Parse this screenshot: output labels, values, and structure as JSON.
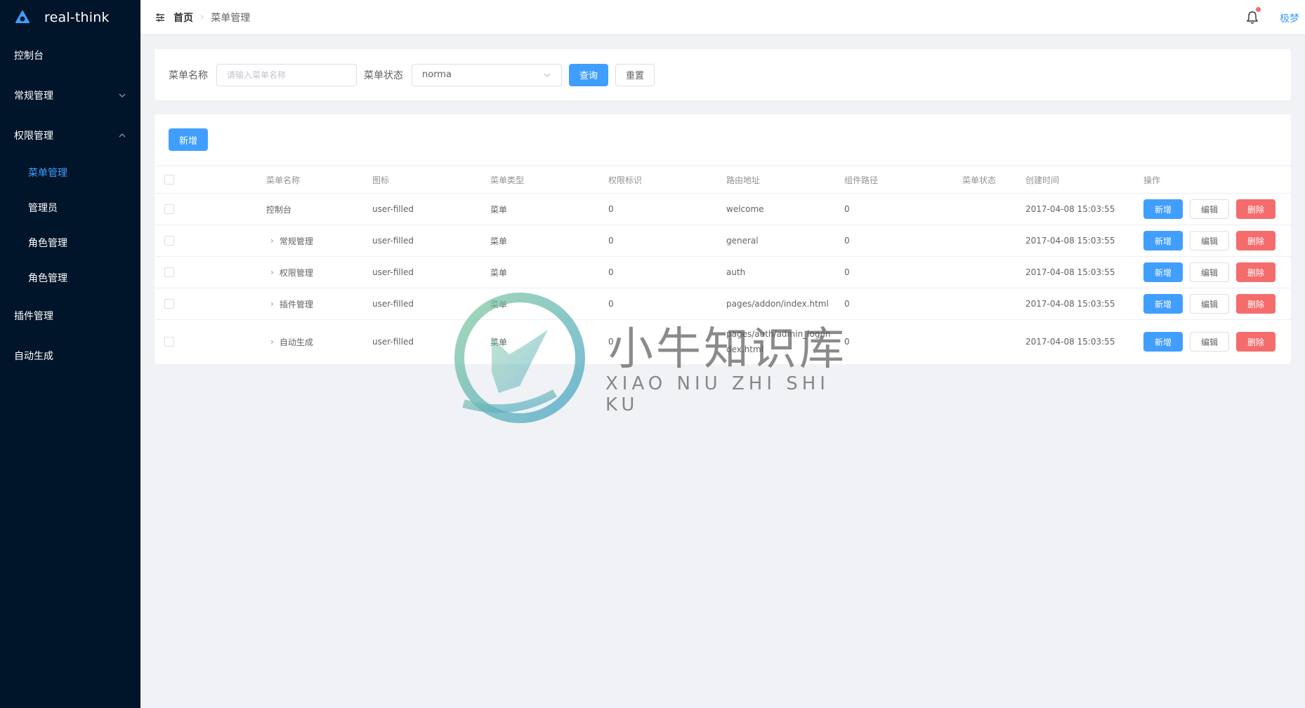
{
  "app": {
    "name": "real-think"
  },
  "sidebar": {
    "items": [
      {
        "label": "控制台"
      },
      {
        "label": "常规管理"
      },
      {
        "label": "权限管理"
      },
      {
        "label": "插件管理"
      },
      {
        "label": "自动生成"
      }
    ],
    "subitems": [
      {
        "label": "菜单管理",
        "active": true
      },
      {
        "label": "管理员"
      },
      {
        "label": "角色管理"
      },
      {
        "label": "角色管理"
      }
    ]
  },
  "header": {
    "breadcrumb_home": "首页",
    "breadcrumb_current": "菜单管理",
    "user": "极梦"
  },
  "search": {
    "name_label": "菜单名称",
    "name_placeholder": "请输入菜单名称",
    "status_label": "菜单状态",
    "status_value": "norma",
    "query_button": "查询",
    "reset_button": "重置"
  },
  "toolbar": {
    "add_label": "新增"
  },
  "table": {
    "columns": [
      "菜单名称",
      "图标",
      "菜单类型",
      "权限标识",
      "路由地址",
      "组件路径",
      "菜单状态",
      "创建时间",
      "操作"
    ],
    "rows": [
      {
        "name": "控制台",
        "icon": "user-filled",
        "type": "菜单",
        "perm": "0",
        "route": "welcome",
        "component": "0",
        "status": "",
        "created": "2017-04-08 15:03:55",
        "expandable": false
      },
      {
        "name": "常规管理",
        "icon": "user-filled",
        "type": "菜单",
        "perm": "0",
        "route": "general",
        "component": "0",
        "status": "",
        "created": "2017-04-08 15:03:55",
        "expandable": true
      },
      {
        "name": "权限管理",
        "icon": "user-filled",
        "type": "菜单",
        "perm": "0",
        "route": "auth",
        "component": "0",
        "status": "",
        "created": "2017-04-08 15:03:55",
        "expandable": true
      },
      {
        "name": "插件管理",
        "icon": "user-filled",
        "type": "菜单",
        "perm": "0",
        "route": "pages/addon/index.html",
        "component": "0",
        "status": "",
        "created": "2017-04-08 15:03:55",
        "expandable": true
      },
      {
        "name": "自动生成",
        "icon": "user-filled",
        "type": "菜单",
        "perm": "0",
        "route": "pages/auth/admin_log/index.html",
        "component": "0",
        "status": "",
        "created": "2017-04-08 15:03:55",
        "expandable": true
      }
    ],
    "op_add": "新增",
    "op_edit": "编辑",
    "op_delete": "删除"
  },
  "watermark": {
    "title": "小牛知识库",
    "subtitle": "XIAO NIU ZHI SHI KU"
  },
  "colors": {
    "primary": "#409eff",
    "danger": "#f56c6c",
    "sidebar_bg": "#001529"
  }
}
